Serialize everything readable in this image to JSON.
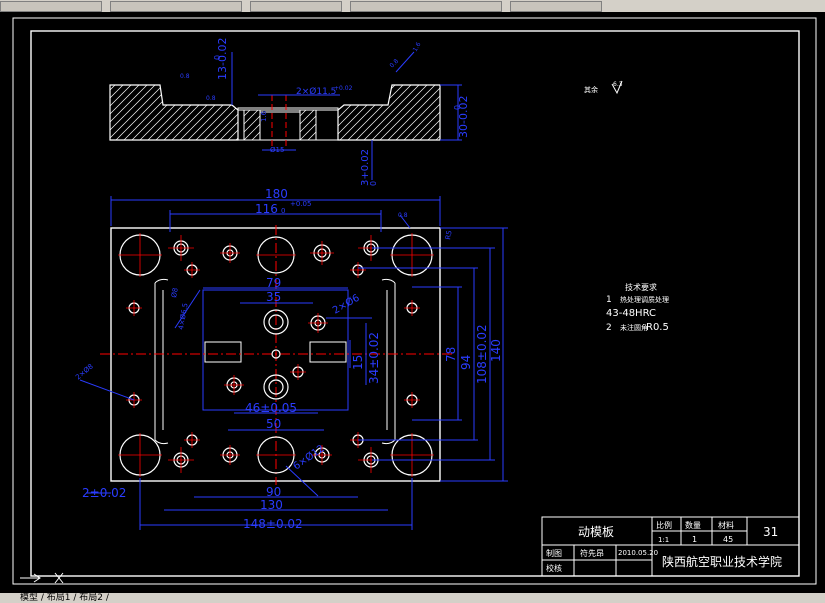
{
  "top_dims": {
    "top_depth": "13-0.02",
    "top_tol0": "0",
    "hole_spec": "2×Ø11.5",
    "hole_tol": "+0.02",
    "height": "30-0.02",
    "height_tol0": "0",
    "step": "3+0.02",
    "step_tol0": "0",
    "small_dia": "Ø15",
    "small_h": "1.6",
    "rough_a": "0.8",
    "rough_b": "0.8",
    "rough_c": "0.8",
    "rough_d": "1.6"
  },
  "plan_dims": {
    "w180": "180",
    "w180_tol": "+0.05",
    "w116": "116",
    "w116_tol": "0",
    "rough_top": "0.8",
    "d79": "79",
    "d35": "35",
    "d2x6": "2×Ø6",
    "d4x": "4×Ø6.5",
    "d4x_b": "Ø8",
    "d15": "15",
    "d34": "34±0.02",
    "d78": "78",
    "d94": "94",
    "d108": "108±0.02",
    "d140": "140",
    "d46": "46±0.05",
    "d50": "50",
    "d6x": "6×Ø12",
    "d90": "90",
    "d130": "130",
    "d148": "148±0.02",
    "d2": "2±0.02",
    "left_label": "2×Ø8",
    "right_mark": "R5"
  },
  "notes": {
    "rest_label": "其余",
    "rest_value": "6.3",
    "title": "技术要求",
    "item1_num": "1",
    "item1_text": "热处理调质处理",
    "item1_value": "43-48HRC",
    "item2_num": "2",
    "item2_text": "未注圆角",
    "item2_value": "R0.5"
  },
  "title_block": {
    "part_name": "动模板",
    "scale_label": "比例",
    "qty_label": "数量",
    "material_label": "材料",
    "drawing_no": "31",
    "scale": "1:1",
    "qty": "1",
    "material": "45",
    "draw_label": "制图",
    "drafter": "符先昂",
    "date": "2010.05.20",
    "check_label": "校核",
    "school": "陕西航空职业技术学院"
  },
  "status": {
    "tabs": "模型 / 布局1 / 布局2 /"
  }
}
